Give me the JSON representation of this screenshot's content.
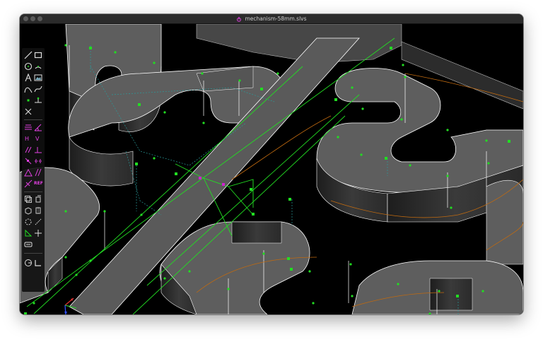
{
  "window": {
    "title": "mechanism-58mm.slvs"
  },
  "toolbar": {
    "groups": [
      {
        "tools": [
          "line-segment-icon",
          "rectangle-icon",
          "circle-icon",
          "arc-icon",
          "text-icon",
          "image-icon",
          "tangent-arc-icon",
          "spline-icon",
          "datum-point-icon",
          "workplane-icon",
          "construction-icon"
        ]
      },
      {
        "tools": [
          "distance-constraint-icon",
          "angle-constraint-icon",
          "horizontal-constraint-icon",
          "vertical-constraint-icon",
          "parallel-constraint-icon",
          "perpendicular-constraint-icon",
          "point-on-entity-icon",
          "symmetric-constraint-icon",
          "equal-constraint-icon",
          "midpoint-constraint-icon",
          "other-constraint-icon"
        ]
      },
      {
        "tools": [
          "step-translate-icon",
          "step-rotate-icon",
          "extrude-icon",
          "lathe-icon",
          "helix-icon",
          "revolve-icon",
          "link-icon",
          "sketch-in-3d-icon",
          "workplane-group-icon"
        ]
      },
      {
        "tools": [
          "nearest-isometric-icon",
          "nearest-ortho-icon"
        ]
      }
    ],
    "ref_label": "REF"
  },
  "axes": {
    "x_color": "#e03030",
    "y_color": "#30c030",
    "z_color": "#3050ff"
  },
  "colors": {
    "solid": "#5e5e5e",
    "edge": "#ffffff",
    "constraint": "#22dd22",
    "construction": "#2a9a9a",
    "highlight": "#d020d0",
    "guide": "#c06a10"
  }
}
